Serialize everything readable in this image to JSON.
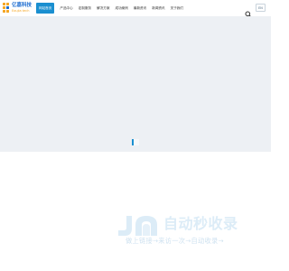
{
  "header": {
    "logo": {
      "name_cn": "亿嘉科技",
      "name_en": "Eoujia tech"
    },
    "nav": [
      {
        "label": "网站首页",
        "active": true
      },
      {
        "label": "产品中心",
        "active": false
      },
      {
        "label": "定制服务",
        "active": false
      },
      {
        "label": "解决方案",
        "active": false
      },
      {
        "label": "成功案例",
        "active": false
      },
      {
        "label": "最新资讯",
        "active": false
      },
      {
        "label": "新闻资讯",
        "active": false
      },
      {
        "label": "关于我们",
        "active": false
      }
    ],
    "search_icon": "search-icon",
    "language_label": "EN"
  },
  "hero": {
    "loading_icon": "loading-indicator"
  },
  "watermark": {
    "title": "自动秒收录",
    "subtitle": "做上链接→来访一次→自动收录→"
  },
  "colors": {
    "brand_blue": "#1a8fd0",
    "logo_orange": "#f5a623",
    "hero_background": "#edf0f4"
  }
}
